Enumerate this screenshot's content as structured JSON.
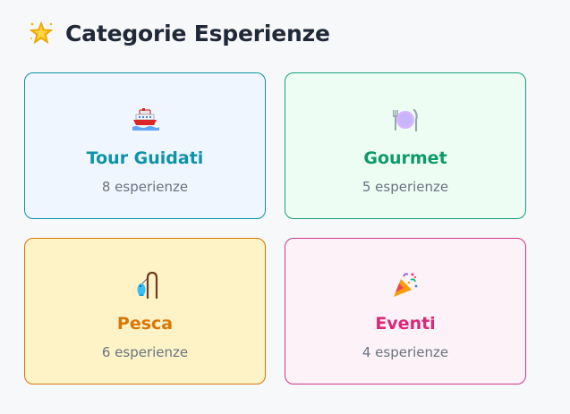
{
  "header": {
    "icon": "glowing-star-icon",
    "title": "Categorie Esperienze"
  },
  "categories": [
    {
      "icon": "ship-icon",
      "label": "Tour Guidati",
      "count": "8 esperienze",
      "color": "#0e93a8",
      "bg": "#eff6ff"
    },
    {
      "icon": "plate-cutlery-icon",
      "label": "Gourmet",
      "count": "5 esperienze",
      "color": "#0f9a6c",
      "bg": "#edfdf4"
    },
    {
      "icon": "fishing-pole-icon",
      "label": "Pesca",
      "count": "6 esperienze",
      "color": "#d97706",
      "bg": "#fef3c7"
    },
    {
      "icon": "party-popper-icon",
      "label": "Eventi",
      "count": "4 esperienze",
      "color": "#db2777",
      "bg": "#fdf2f8"
    }
  ]
}
